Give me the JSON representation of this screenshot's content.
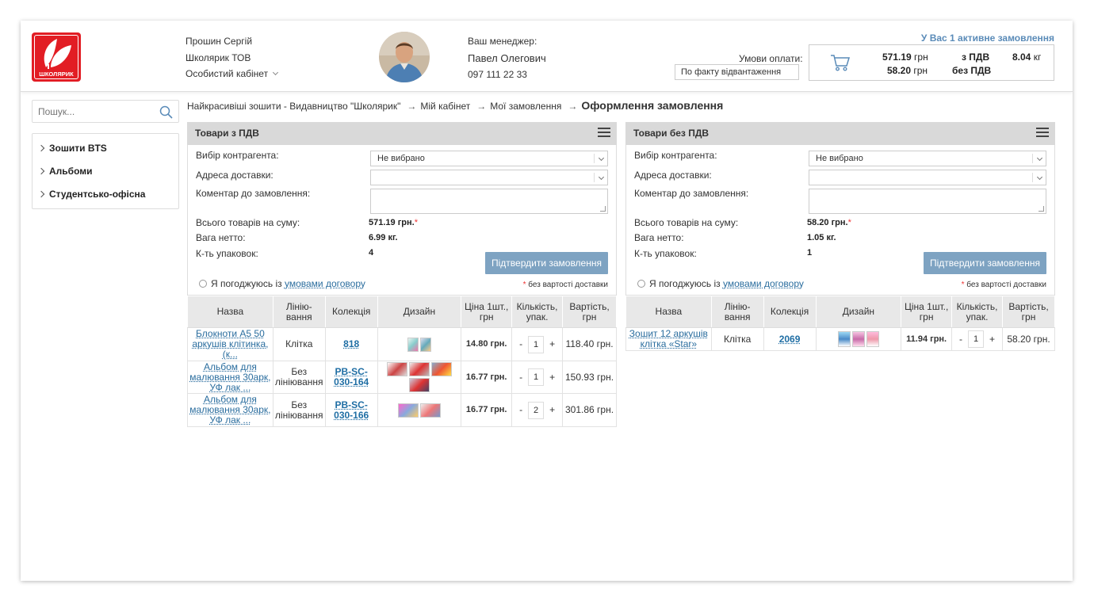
{
  "header": {
    "logo_text": "ШКОЛЯРИК",
    "user": {
      "name": "Прошин Сергій",
      "company": "Школярик ТОВ",
      "cabinet": "Особистий кабінет"
    },
    "manager": {
      "label": "Ваш менеджер:",
      "name": "Павел Олегович",
      "phone": "097 111 22 33"
    },
    "payment": {
      "label": "Умови оплати:",
      "value": "По факту відвантаження"
    },
    "active_orders": "У Вас 1 активне замовлення",
    "cart": {
      "sum_vat": "571.19",
      "sum_vat_label": "з ПДВ",
      "sum_novat": "58.20",
      "sum_novat_label": "без ПДВ",
      "currency": "грн",
      "weight": "8.04",
      "weight_unit": "кг"
    }
  },
  "sidebar": {
    "search_placeholder": "Пошук...",
    "items": [
      {
        "label": "Зошити BTS"
      },
      {
        "label": "Альбоми"
      },
      {
        "label": "Студентсько-офісна"
      }
    ]
  },
  "breadcrumb": {
    "items": [
      "Найкрасивіші зошити - Видавництво \"Школярик\"",
      "Мій кабінет",
      "Мої замовлення"
    ],
    "current": "Оформлення замовлення"
  },
  "common": {
    "contractor_label": "Вибір контрагента:",
    "address_label": "Адреса доставки:",
    "comment_label": "Коментар до замовлення:",
    "total_label": "Всього товарів на суму:",
    "weight_label": "Вага нетто:",
    "packs_label": "К-ть упаковок:",
    "confirm_label": "Підтвердити замовлення",
    "agree_text": "Я погоджуюсь із",
    "agree_link": "умовами договору",
    "note_star": "*",
    "note_text": "без вартості доставки",
    "col_name": "Назва",
    "col_lining": "Лінію-вання",
    "col_collection": "Колекція",
    "col_design": "Дизайн",
    "col_price": "Ціна 1шт., грн",
    "col_qty": "Кількість, упак.",
    "col_cost": "Вартість, грн",
    "minus": "-",
    "plus": "+"
  },
  "panel_vat": {
    "title": "Товари з ПДВ",
    "contractor": "Не вибрано",
    "total": "571.19 грн.",
    "weight": "6.99 кг.",
    "packs": "4",
    "rows": [
      {
        "name": "Блокноти А5 50 аркушів клітинка, (к...",
        "lining": "Клітка",
        "collection": "818",
        "price": "14.80 грн.",
        "qty": "1",
        "cost": "118.40 грн."
      },
      {
        "name": "Альбом для малювання 30арк, УФ лак ...",
        "lining": "Без лініювання",
        "collection": "PB-SC-030-164",
        "price": "16.77 грн.",
        "qty": "1",
        "cost": "150.93 грн."
      },
      {
        "name": "Альбом для малювання 30арк, УФ лак ...",
        "lining": "Без лініювання",
        "collection": "PB-SC-030-166",
        "price": "16.77 грн.",
        "qty": "2",
        "cost": "301.86 грн."
      }
    ]
  },
  "panel_novat": {
    "title": "Товари без ПДВ",
    "contractor": "Не вибрано",
    "total": "58.20 грн.",
    "weight": "1.05 кг.",
    "packs": "1",
    "rows": [
      {
        "name": "Зошит 12 аркушів клітка «Star»",
        "lining": "Клітка",
        "collection": "2069",
        "price": "11.94 грн.",
        "qty": "1",
        "cost": "58.20 грн."
      }
    ]
  },
  "colors": {
    "accent": "#5a8bb8",
    "button": "#7ea3c2",
    "logo": "#e21d24",
    "link": "#2a6d9e"
  }
}
